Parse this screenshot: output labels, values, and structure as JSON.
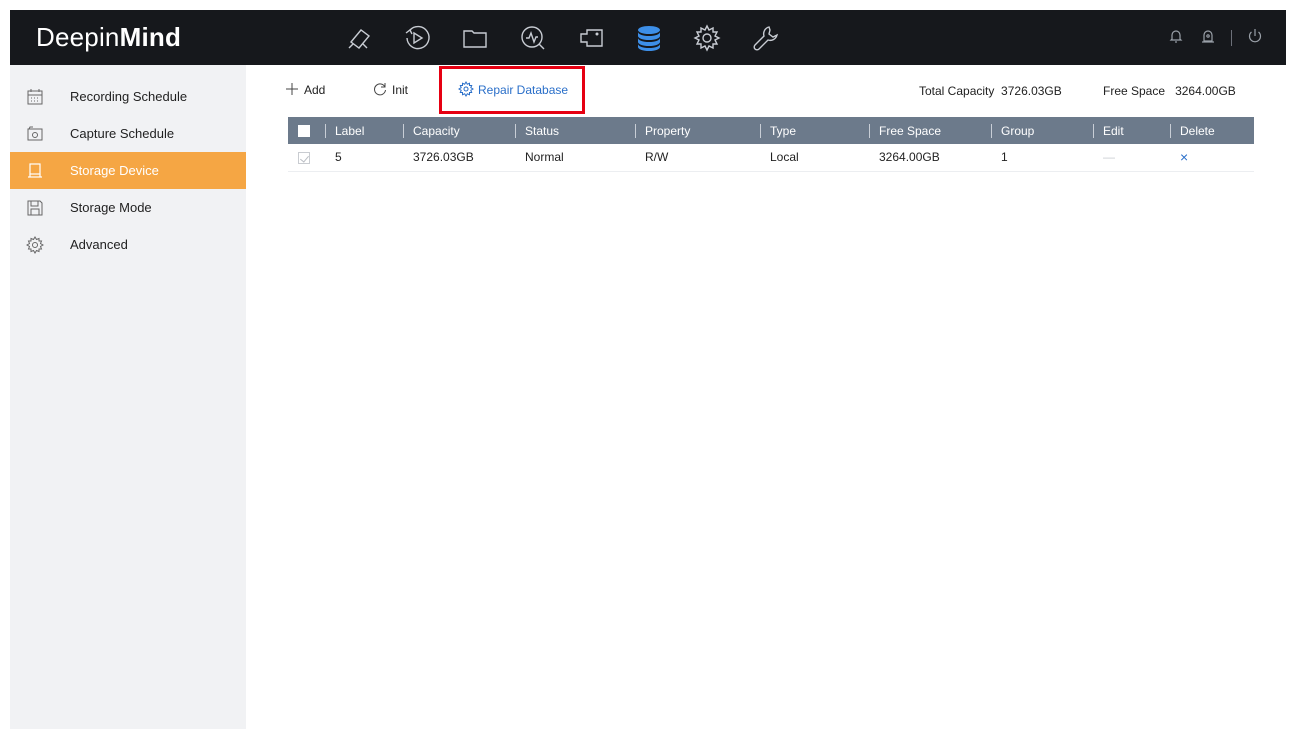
{
  "app": {
    "logo_regular": "Deepin",
    "logo_bold": "Mind"
  },
  "top_nav": [
    {
      "name": "live-view-icon"
    },
    {
      "name": "playback-icon"
    },
    {
      "name": "file-management-icon"
    },
    {
      "name": "smart-analysis-icon"
    },
    {
      "name": "camera-icon"
    },
    {
      "name": "storage-icon",
      "active": true
    },
    {
      "name": "settings-icon"
    },
    {
      "name": "maintenance-icon"
    }
  ],
  "sidebar": {
    "items": [
      {
        "label": "Recording Schedule",
        "icon": "calendar-icon"
      },
      {
        "label": "Capture Schedule",
        "icon": "camera-icon"
      },
      {
        "label": "Storage Device",
        "icon": "hdd-icon",
        "active": true
      },
      {
        "label": "Storage Mode",
        "icon": "storage-mode-icon"
      },
      {
        "label": "Advanced",
        "icon": "gear-icon"
      }
    ]
  },
  "toolbar": {
    "add_label": "Add",
    "init_label": "Init",
    "repair_label": "Repair Database",
    "total_capacity_label": "Total Capacity",
    "total_capacity_value": "3726.03GB",
    "free_space_label": "Free Space",
    "free_space_value": "3264.00GB"
  },
  "table": {
    "columns": [
      "Label",
      "Capacity",
      "Status",
      "Property",
      "Type",
      "Free Space",
      "Group",
      "Edit",
      "Delete"
    ],
    "rows": [
      {
        "label": "5",
        "capacity": "3726.03GB",
        "status": "Normal",
        "property": "R/W",
        "type": "Local",
        "free_space": "3264.00GB",
        "group": "1",
        "edit": "—",
        "delete": "×"
      }
    ]
  },
  "colors": {
    "accent": "#f5a644",
    "link": "#2a6fc9",
    "header": "#6c7a8b",
    "highlight": "#e60012",
    "topbar": "#16181c",
    "active_nav": "#3d8fe8"
  }
}
